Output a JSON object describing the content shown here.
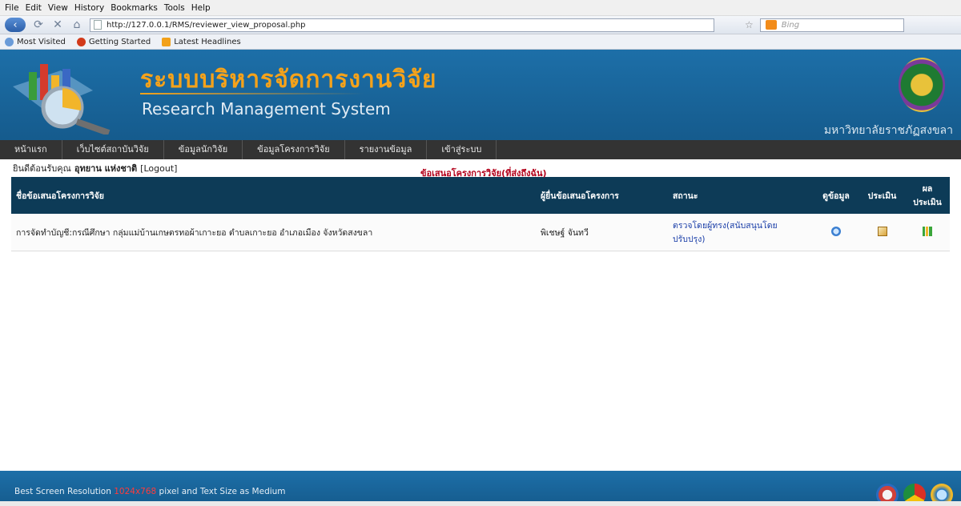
{
  "browser": {
    "menu": [
      "File",
      "Edit",
      "View",
      "History",
      "Bookmarks",
      "Tools",
      "Help"
    ],
    "url": "http://127.0.0.1/RMS/reviewer_view_proposal.php",
    "search_placeholder": "Bing",
    "bookmarks": [
      "Most Visited",
      "Getting Started",
      "Latest Headlines"
    ]
  },
  "header": {
    "title_th": "ระบบบริหารจัดการงานวิจัย",
    "title_en": "Research Management System",
    "university": "มหาวิทยาลัยราชภัฏสงขลา"
  },
  "nav": {
    "items": [
      "หน้าแรก",
      "เว็บไซต์สถาบันวิจัย",
      "ข้อมูลนักวิจัย",
      "ข้อมูลโครงการวิจัย",
      "รายงานข้อมูล",
      "เข้าสู่ระบบ"
    ]
  },
  "welcome": {
    "prefix": "ยินดีต้อนรับคุณ",
    "name": "อุทยาน แห่งชาติ",
    "logout": "[Logout]"
  },
  "table": {
    "caption": "ข้อเสนอโครงการวิจัย(ที่ส่งถึงฉัน)",
    "headers": [
      "ชื่อข้อเสนอโครงการวิจัย",
      "ผู้ยื่นข้อเสนอโครงการ",
      "สถานะ",
      "ดูข้อมูล",
      "ประเมิน",
      "ผลประเมิน"
    ],
    "rows": [
      {
        "title": "การจัดทำบัญชี:กรณีศึกษา กลุ่มแม่บ้านเกษตรทอผ้าเกาะยอ ตำบลเกาะยอ อำเภอเมือง จังหวัดสงขลา",
        "submitter": "พิเชษฐ์ จันทวี",
        "status": "ตรวจโดยผู้ทรง(สนับสนุนโดยปรับปรุง)"
      }
    ]
  },
  "footer": {
    "text_before": "Best Screen Resolution ",
    "resolution": "1024x768",
    "text_after": " pixel and Text Size as Medium"
  }
}
